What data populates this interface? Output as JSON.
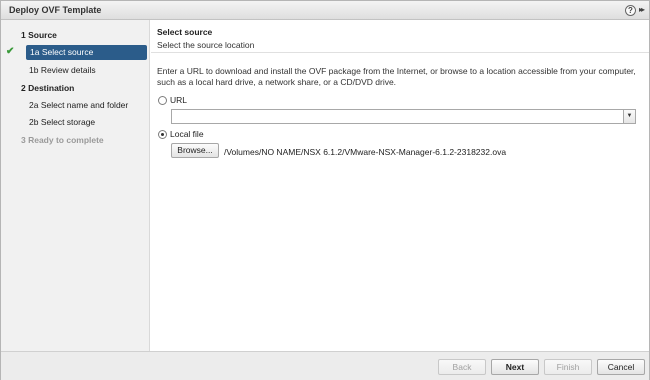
{
  "window": {
    "title": "Deploy OVF Template",
    "help_icon": "?",
    "expand_icon": "▸▸"
  },
  "sidebar": {
    "steps": [
      {
        "label": "1  Source",
        "type": "section"
      },
      {
        "label": "1a  Select source",
        "type": "sub",
        "active": true,
        "completed": true
      },
      {
        "label": "1b  Review details",
        "type": "sub"
      },
      {
        "label": "2  Destination",
        "type": "section"
      },
      {
        "label": "2a  Select name and folder",
        "type": "sub"
      },
      {
        "label": "2b  Select storage",
        "type": "sub"
      },
      {
        "label": "3  Ready to complete",
        "type": "section",
        "disabled": true
      }
    ],
    "check_icon": "✔"
  },
  "main": {
    "heading": "Select source",
    "subheading": "Select the source location",
    "instructions": "Enter a URL to download and install the OVF package from the Internet, or browse to a location accessible from your computer, such as a local hard drive, a network share, or a CD/DVD drive.",
    "url_option": {
      "label": "URL",
      "selected": false,
      "value": ""
    },
    "local_option": {
      "label": "Local file",
      "selected": true
    },
    "browse_label": "Browse...",
    "file_path": "/Volumes/NO NAME/NSX 6.1.2/VMware-NSX-Manager-6.1.2-2318232.ova",
    "combo_arrow": "▼"
  },
  "footer": {
    "back_label": "Back",
    "next_label": "Next",
    "finish_label": "Finish",
    "cancel_label": "Cancel"
  }
}
